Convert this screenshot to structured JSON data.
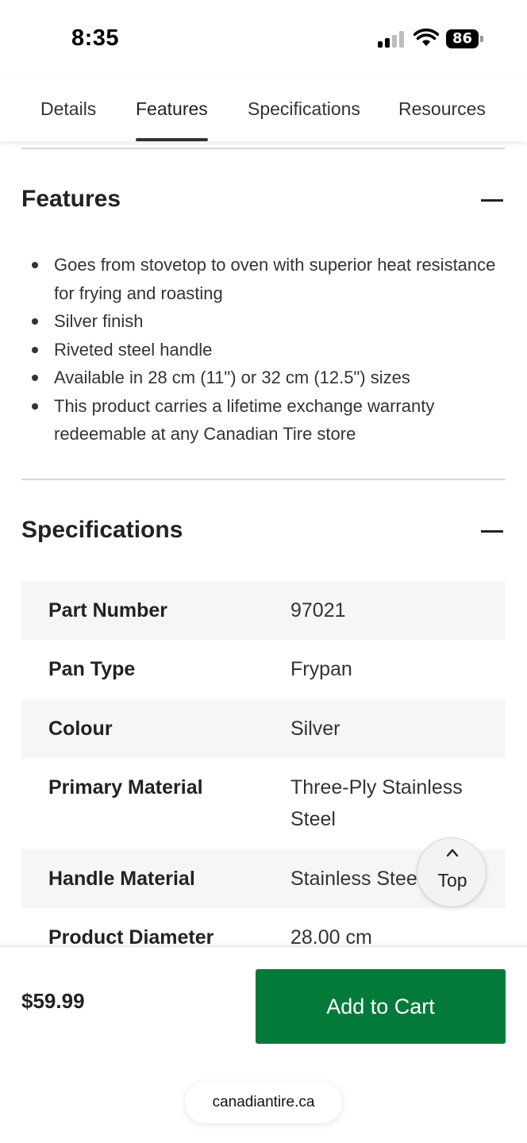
{
  "status_bar": {
    "time": "8:35",
    "battery_level": "86",
    "signal_bars_active": 2,
    "signal_bars_total": 4
  },
  "tabs": [
    {
      "label": "Details",
      "active": false
    },
    {
      "label": "Features",
      "active": true
    },
    {
      "label": "Specifications",
      "active": false
    },
    {
      "label": "Resources",
      "active": false
    }
  ],
  "features": {
    "title": "Features",
    "items": [
      "Goes from stovetop to oven with superior heat resistance for frying and roasting",
      "Silver finish",
      "Riveted steel handle",
      "Available in 28 cm (11\") or 32 cm (12.5\") sizes",
      "This product carries a lifetime exchange warranty redeemable at any Canadian Tire store"
    ]
  },
  "specifications": {
    "title": "Specifications",
    "rows": [
      {
        "label": "Part Number",
        "value": "97021"
      },
      {
        "label": "Pan Type",
        "value": "Frypan"
      },
      {
        "label": "Colour",
        "value": "Silver"
      },
      {
        "label": "Primary Material",
        "value": "Three-Ply Stainless Steel"
      },
      {
        "label": "Handle Material",
        "value": "Stainless Stee"
      },
      {
        "label": "Product Diameter",
        "value": "28.00 cm"
      }
    ]
  },
  "top_button": {
    "label": "Top"
  },
  "footer": {
    "price": "$59.99",
    "add_to_cart_label": "Add to Cart",
    "url": "canadiantire.ca"
  },
  "colors": {
    "brand_green": "#047a3a",
    "row_shade": "#f6f6f6"
  }
}
